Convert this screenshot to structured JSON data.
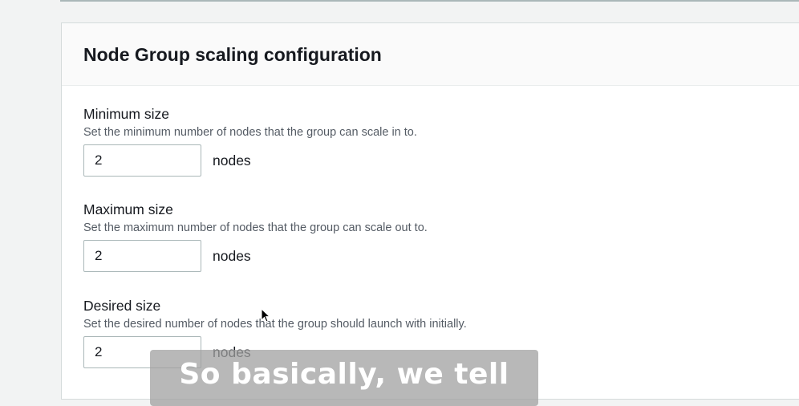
{
  "panel": {
    "title": "Node Group scaling configuration"
  },
  "fields": [
    {
      "label": "Minimum size",
      "description": "Set the minimum number of nodes that the group can scale in to.",
      "value": "2",
      "unit": "nodes"
    },
    {
      "label": "Maximum size",
      "description": "Set the maximum number of nodes that the group can scale out to.",
      "value": "2",
      "unit": "nodes"
    },
    {
      "label": "Desired size",
      "description": "Set the desired number of nodes that the group should launch with initially.",
      "value": "2",
      "unit": "nodes"
    }
  ],
  "caption": {
    "text": "So basically, we tell"
  },
  "colors": {
    "panel_bg": "#ffffff",
    "page_bg": "#f2f3f3",
    "text": "#16191f",
    "description": "#545b64",
    "input_border": "#aab7b8"
  },
  "icons": {
    "pointer": "mouse-pointer-icon"
  }
}
